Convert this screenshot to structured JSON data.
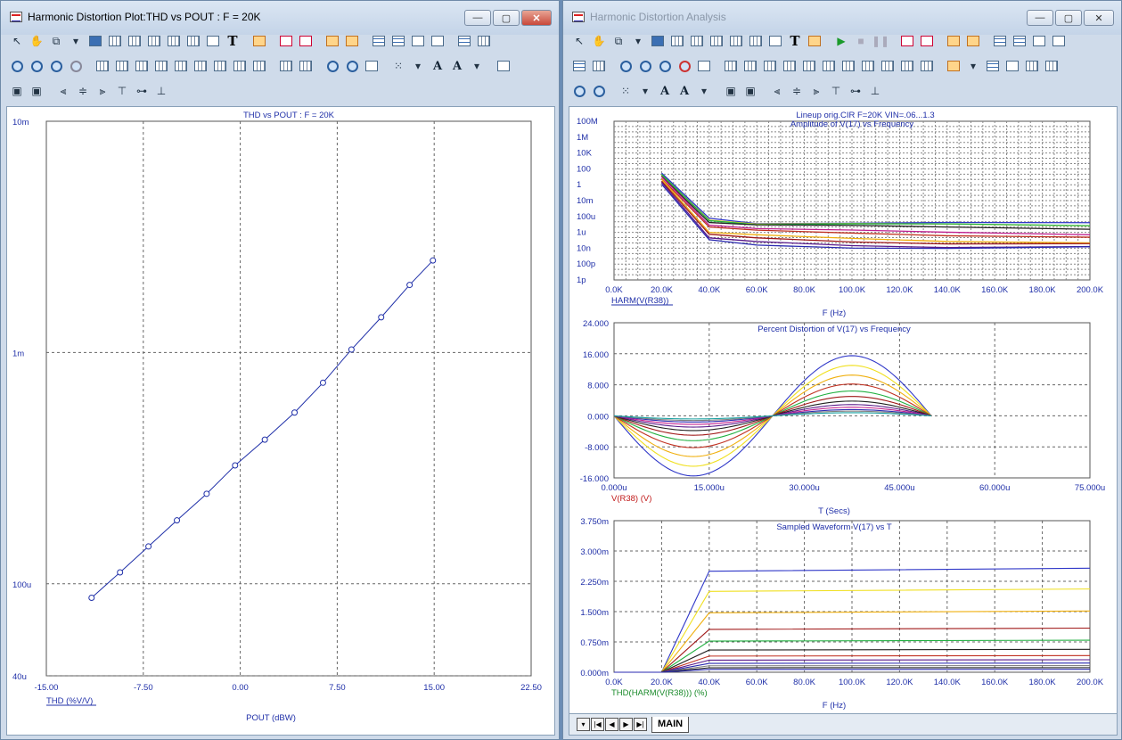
{
  "left_window": {
    "title": "Harmonic Distortion Plot:THD vs POUT : F = 20K",
    "controls": {
      "minimize": "—",
      "maximize": "▢",
      "close": "✕"
    },
    "plot": {
      "title": "THD vs POUT : F = 20K",
      "y_ticks": [
        "10m",
        "1m",
        "100u",
        "40u"
      ],
      "x_ticks": [
        "-15.00",
        "-7.50",
        "0.00",
        "7.50",
        "15.00",
        "22.50"
      ],
      "series_label": "THD (%V/V)",
      "x_axis_label": "POUT (dBW)"
    }
  },
  "right_window": {
    "title": "Harmonic Distortion Analysis",
    "controls": {
      "minimize": "—",
      "maximize": "▢",
      "close": "✕"
    },
    "plot1": {
      "header": "Lineup orig.CIR F=20K VIN=.06...1.3",
      "title": "Amplitude of V(17) vs Frequency",
      "y_ticks": [
        "100M",
        "1M",
        "10K",
        "100",
        "1",
        "10m",
        "100u",
        "1u",
        "10n",
        "100p",
        "1p"
      ],
      "x_ticks": [
        "0.0K",
        "20.0K",
        "40.0K",
        "60.0K",
        "80.0K",
        "100.0K",
        "120.0K",
        "140.0K",
        "160.0K",
        "180.0K",
        "200.0K"
      ],
      "series_label": "HARM(V(R38))",
      "x_axis_label": "F (Hz)"
    },
    "plot2": {
      "title": "Percent Distortion of V(17) vs Frequency",
      "y_ticks": [
        "24.000",
        "16.000",
        "8.000",
        "0.000",
        "-8.000",
        "-16.000"
      ],
      "x_ticks": [
        "0.000u",
        "15.000u",
        "30.000u",
        "45.000u",
        "60.000u",
        "75.000u"
      ],
      "series_label": "V(R38) (V)",
      "x_axis_label": "T (Secs)"
    },
    "plot3": {
      "title": "Sampled Waveform  V(17) vs T",
      "y_ticks": [
        "3.750m",
        "3.000m",
        "2.250m",
        "1.500m",
        "0.750m",
        "0.000m"
      ],
      "x_ticks": [
        "0.0K",
        "20.0K",
        "40.0K",
        "60.0K",
        "80.0K",
        "100.0K",
        "120.0K",
        "140.0K",
        "160.0K",
        "180.0K",
        "200.0K"
      ],
      "series_label": "THD(HARM(V(R38))) (%)",
      "x_axis_label": "F (Hz)"
    },
    "tabs": {
      "active": "MAIN"
    }
  },
  "colors": {
    "blue": "#1f2fa8",
    "red": "#c01818",
    "green": "#1a8a2a",
    "trace_palette": [
      "#2f37c8",
      "#f0e020",
      "#f0b010",
      "#c03020",
      "#20b040",
      "#a01818",
      "#202020",
      "#5a1a8a",
      "#c02090",
      "#2a2ab0",
      "#808080",
      "#1aa0a0"
    ]
  },
  "chart_data": [
    {
      "type": "line",
      "title": "THD vs POUT : F = 20K",
      "xlabel": "POUT (dBW)",
      "ylabel": "THD (%V/V)",
      "x_scale": "linear",
      "y_scale": "log",
      "xlim": [
        -15,
        22.5
      ],
      "ylim": [
        4e-05,
        0.01
      ],
      "series": [
        {
          "name": "THD (%V/V)",
          "x": [
            -11.5,
            -9.3,
            -7.1,
            -4.9,
            -2.6,
            -0.4,
            1.9,
            4.2,
            6.4,
            8.6,
            10.9,
            13.1,
            14.9
          ],
          "y": [
            8.7e-05,
            0.000112,
            0.000145,
            0.000188,
            0.000245,
            0.000325,
            0.00042,
            0.00055,
            0.00074,
            0.00103,
            0.00142,
            0.00196,
            0.0025
          ]
        }
      ]
    },
    {
      "type": "line",
      "title": "Amplitude of V(17) vs Frequency",
      "xlabel": "F (Hz)",
      "y_scale": "log",
      "xlim": [
        0,
        200000
      ],
      "ylim": [
        1e-12,
        100000000.0
      ],
      "series": [
        {
          "name": "HARM(V(R38))",
          "x": [
            20000,
            40000,
            60000,
            100000,
            140000,
            200000
          ],
          "y": [
            30,
            6e-05,
            2e-05,
            1.5e-05,
            1.2e-05,
            1e-05
          ]
        },
        {
          "x": [
            20000,
            40000,
            60000,
            100000,
            140000,
            200000
          ],
          "y": [
            20,
            3e-05,
            1e-05,
            8e-06,
            7e-06,
            6e-06
          ]
        },
        {
          "x": [
            20000,
            40000,
            60000,
            100000,
            140000,
            200000
          ],
          "y": [
            10,
            8e-06,
            2e-06,
            1.2e-06,
            9e-07,
            7e-07
          ]
        },
        {
          "x": [
            20000,
            40000,
            60000,
            100000,
            140000,
            200000
          ],
          "y": [
            5,
            1e-06,
            3e-07,
            1.5e-07,
            1e-07,
            8e-08
          ]
        },
        {
          "x": [
            20000,
            40000,
            60000,
            100000,
            140000,
            200000
          ],
          "y": [
            2,
            2e-07,
            6e-08,
            3e-08,
            2e-08,
            2e-08
          ]
        }
      ]
    },
    {
      "type": "line",
      "title": "Percent Distortion of V(17) vs Frequency",
      "xlabel": "T (Secs)",
      "ylabel": "V(R38) (V)",
      "xlim": [
        0,
        7.5e-05
      ],
      "ylim": [
        -16,
        24
      ],
      "x_period": 5e-05,
      "amplitudes": [
        15.5,
        13,
        10.5,
        8.2,
        6.4,
        5,
        3.8,
        2.9,
        2.2,
        1.6,
        1.2,
        0.8
      ]
    },
    {
      "type": "line",
      "title": "Sampled Waveform  V(17) vs T",
      "xlabel": "F (Hz)",
      "ylabel": "THD(HARM(V(R38))) (%)",
      "xlim": [
        0,
        200000
      ],
      "ylim": [
        0,
        0.00375
      ],
      "x": [
        0,
        20000,
        40000,
        200000
      ],
      "levels": [
        0.0025,
        0.002,
        0.00147,
        0.00106,
        0.00077,
        0.00055,
        0.0004,
        0.0003,
        0.00022,
        0.00016,
        0.00011,
        7e-05
      ]
    }
  ]
}
